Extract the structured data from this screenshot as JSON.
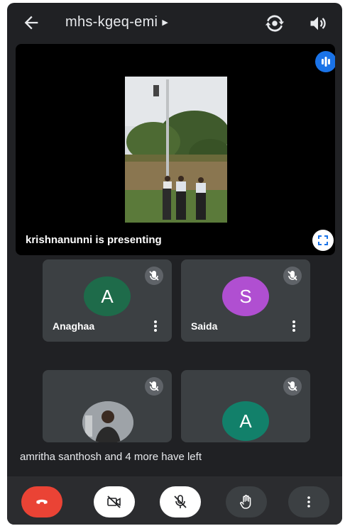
{
  "meeting": {
    "code": "mhs-kgeq-emi"
  },
  "presentation": {
    "caption": "krishnanunni is presenting"
  },
  "participants": [
    {
      "name": "Anaghaa",
      "initial": "A",
      "color": "#1e6b4a",
      "muted": true
    },
    {
      "name": "Saida",
      "initial": "S",
      "color": "#b04fd1",
      "muted": true
    },
    {
      "name": "",
      "initial": "",
      "muted": true,
      "has_photo": true
    },
    {
      "name": "",
      "initial": "A",
      "color": "#12806a",
      "muted": true
    }
  ],
  "notification": {
    "text": "amritha santhosh and 4 more have left"
  },
  "controls": {
    "end_call_color": "#ea4335",
    "icons": [
      "end-call-icon",
      "camera-off-icon",
      "mic-off-icon",
      "raise-hand-icon",
      "more-options-icon"
    ]
  }
}
